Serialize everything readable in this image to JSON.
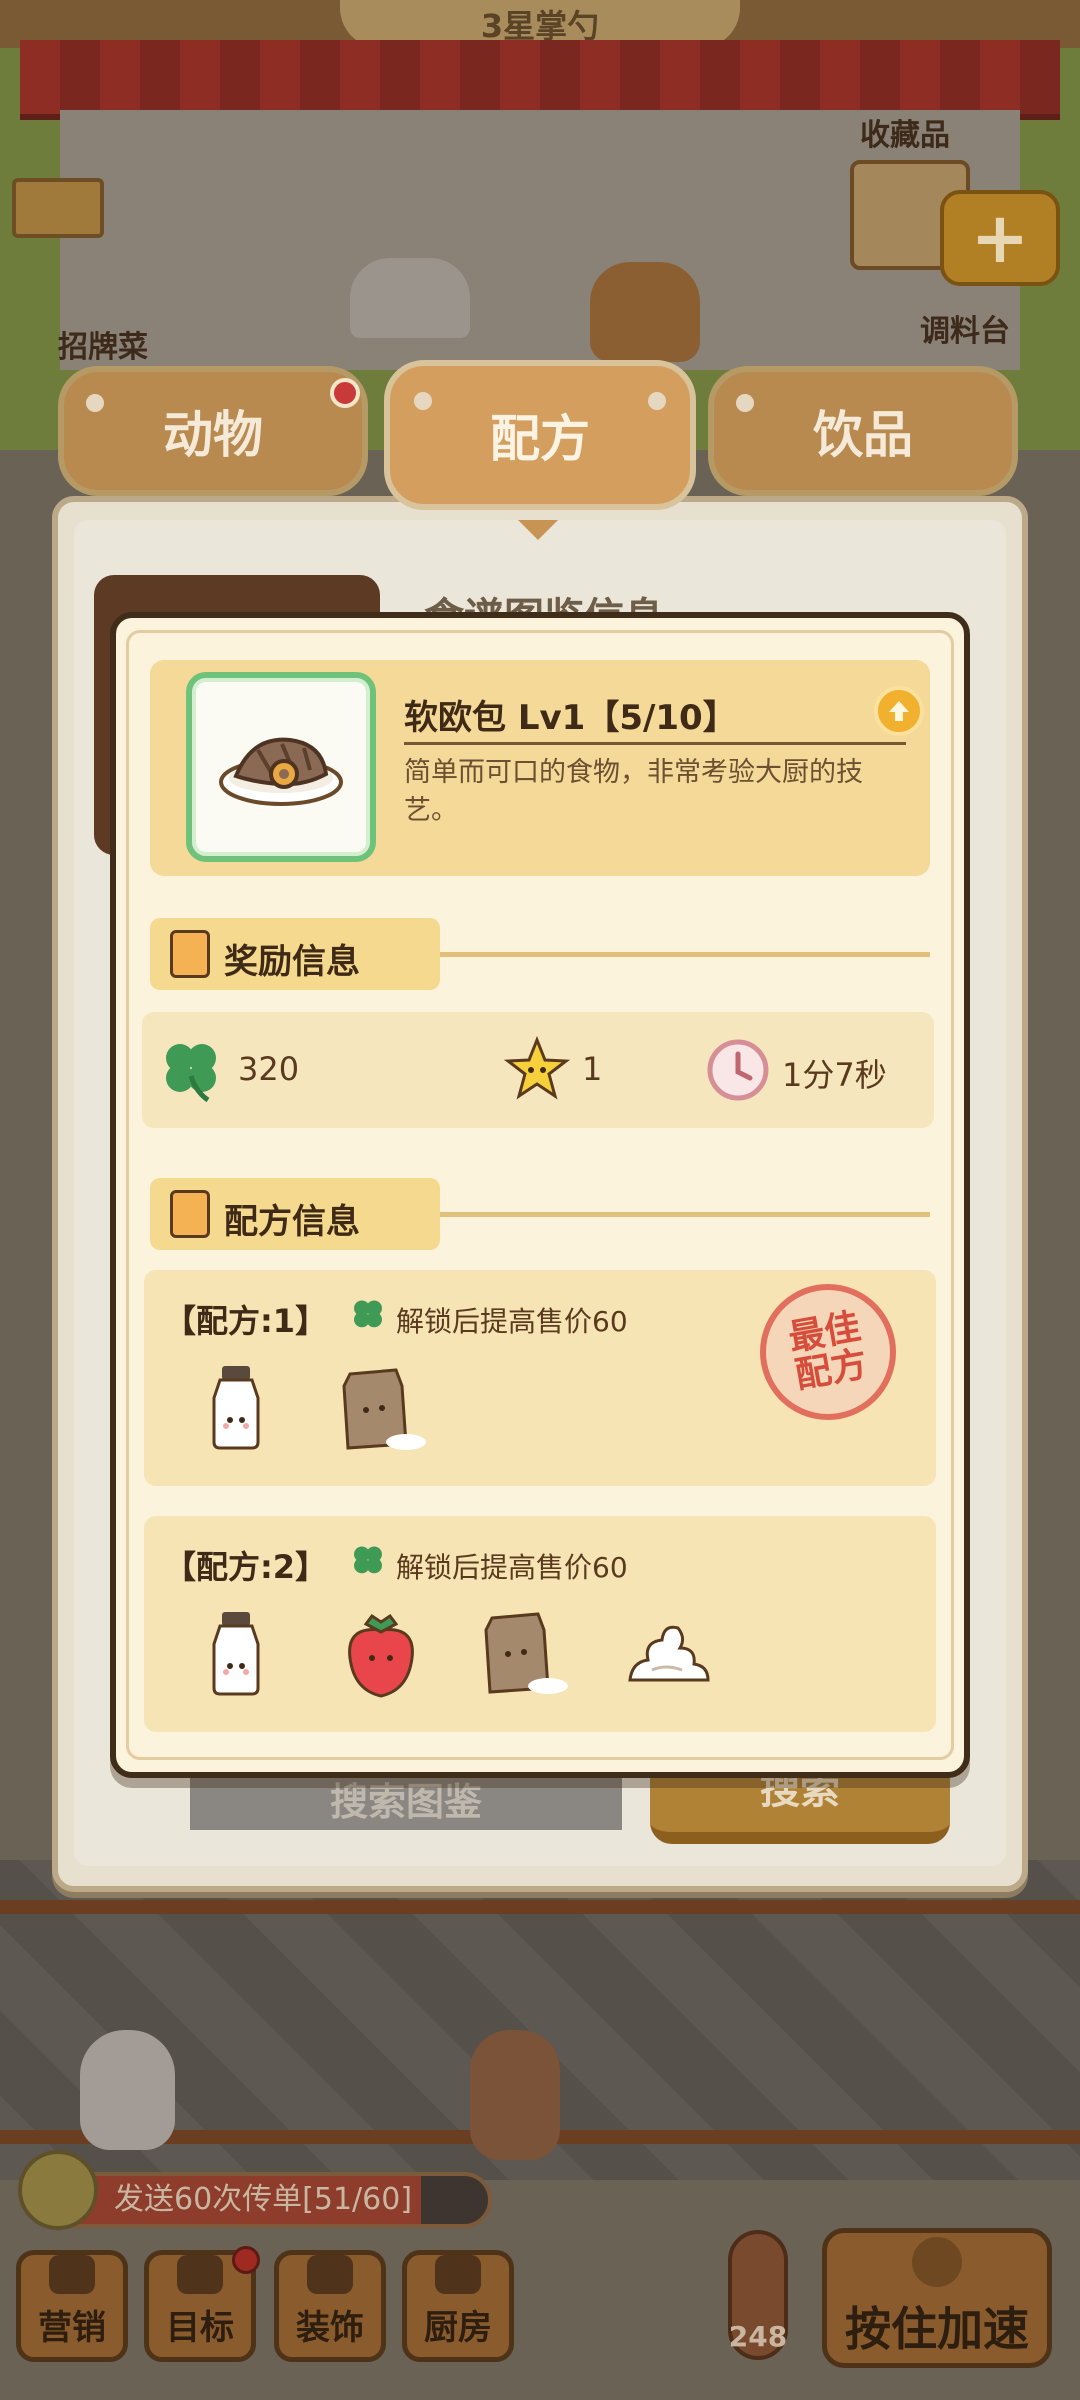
{
  "background": {
    "roof_sign": "3星掌勺",
    "signature_label": "招牌菜",
    "collection_label": "收藏品",
    "seasoning_label": "调料台"
  },
  "tabs": [
    {
      "label": "动物",
      "has_badge": true
    },
    {
      "label": "配方",
      "selected": true
    },
    {
      "label": "饮品"
    }
  ],
  "behind_popup": {
    "title": "食谱图鉴信息",
    "search_placeholder": "搜索图鉴",
    "search_button": "搜索"
  },
  "popup": {
    "food": {
      "name": "软欧包 Lv1【5/10】",
      "description": "简单而可口的食物，非常考验大厨的技艺。",
      "icon": "bread-roll-icon"
    },
    "reward_section": {
      "title": "奖励信息",
      "clover": "320",
      "stars": "1",
      "time": "1分7秒"
    },
    "recipe_section": {
      "title": "配方信息",
      "recipes": [
        {
          "title": "【配方:1】",
          "hint": "解锁后提高售价60",
          "ingredients": [
            "milk-bottle-icon",
            "flour-bag-icon"
          ],
          "stamp": "最佳配方"
        },
        {
          "title": "【配方:2】",
          "hint": "解锁后提高售价60",
          "ingredients": [
            "milk-bottle-icon",
            "strawberry-icon",
            "flour-bag-icon",
            "whipped-cream-icon"
          ]
        }
      ]
    }
  },
  "bottom_bar": {
    "quest_text": "发送60次传单[51/60]",
    "quest_progress": 0.85,
    "buttons": [
      "营销",
      "目标",
      "装饰",
      "厨房"
    ],
    "thermometer_value": "248",
    "speed_button": "按住加速"
  },
  "colors": {
    "accent_orange": "#d49f5e",
    "clover_green": "#3f9a55",
    "frame_green": "#6fc27a",
    "stamp_red": "#d64d3c"
  }
}
